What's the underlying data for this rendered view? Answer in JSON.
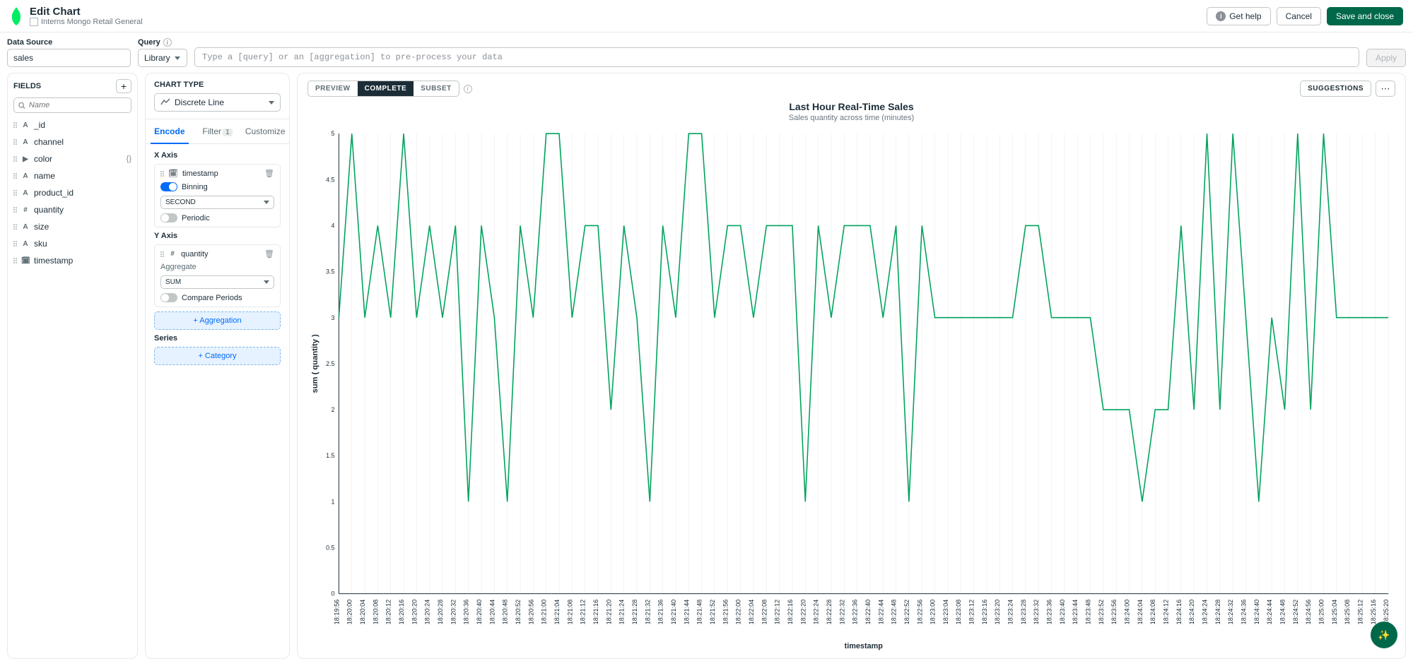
{
  "header": {
    "title": "Edit Chart",
    "breadcrumb": "Interns Mongo Retail General",
    "get_help": "Get help",
    "cancel": "Cancel",
    "save": "Save and close"
  },
  "query": {
    "data_source_label": "Data Source",
    "data_source_value": "sales",
    "query_label": "Query",
    "library_label": "Library",
    "query_placeholder": "Type a [query] or an [aggregation] to pre-process your data",
    "apply": "Apply"
  },
  "fields": {
    "header": "FIELDS",
    "search_placeholder": "Name",
    "items": [
      {
        "icon": "A",
        "name": "_id"
      },
      {
        "icon": "A",
        "name": "channel"
      },
      {
        "icon": "▶",
        "name": "color",
        "extra": "{}"
      },
      {
        "icon": "A",
        "name": "name"
      },
      {
        "icon": "A",
        "name": "product_id"
      },
      {
        "icon": "#",
        "name": "quantity"
      },
      {
        "icon": "A",
        "name": "size"
      },
      {
        "icon": "A",
        "name": "sku"
      },
      {
        "icon": "🗓",
        "name": "timestamp"
      }
    ]
  },
  "config": {
    "chart_type_label": "CHART TYPE",
    "chart_type_value": "Discrete Line",
    "tabs": {
      "encode": "Encode",
      "filter": "Filter",
      "filter_badge": "1",
      "customize": "Customize"
    },
    "x_axis_label": "X Axis",
    "x_field": "timestamp",
    "binning_label": "Binning",
    "binning_value": "SECOND",
    "periodic_label": "Periodic",
    "y_axis_label": "Y Axis",
    "y_field": "quantity",
    "aggregate_label": "Aggregate",
    "aggregate_value": "SUM",
    "compare_label": "Compare Periods",
    "add_agg": "+ Aggregation",
    "series_label": "Series",
    "add_cat": "+ Category"
  },
  "chart": {
    "tabs": {
      "preview": "PREVIEW",
      "complete": "COMPLETE",
      "subset": "SUBSET"
    },
    "suggestions": "SUGGESTIONS",
    "title": "Last Hour Real-Time Sales",
    "subtitle": "Sales quantity across time (minutes)",
    "ylabel": "sum ( quantity )",
    "xlabel": "timestamp",
    "yticks": [
      "0",
      "0.5",
      "1",
      "1.5",
      "2",
      "2.5",
      "3",
      "3.5",
      "4",
      "4.5",
      "5"
    ],
    "color": "#00a35c"
  },
  "chart_data": {
    "type": "line",
    "title": "Last Hour Real-Time Sales",
    "subtitle": "Sales quantity across time (minutes)",
    "xlabel": "timestamp",
    "ylabel": "sum ( quantity )",
    "ylim": [
      0,
      5
    ],
    "categories": [
      "18:19:56",
      "18:20:00",
      "18:20:04",
      "18:20:08",
      "18:20:12",
      "18:20:16",
      "18:20:20",
      "18:20:24",
      "18:20:28",
      "18:20:32",
      "18:20:36",
      "18:20:40",
      "18:20:44",
      "18:20:48",
      "18:20:52",
      "18:20:56",
      "18:21:00",
      "18:21:04",
      "18:21:08",
      "18:21:12",
      "18:21:16",
      "18:21:20",
      "18:21:24",
      "18:21:28",
      "18:21:32",
      "18:21:36",
      "18:21:40",
      "18:21:44",
      "18:21:48",
      "18:21:52",
      "18:21:56",
      "18:22:00",
      "18:22:04",
      "18:22:08",
      "18:22:12",
      "18:22:16",
      "18:22:20",
      "18:22:24",
      "18:22:28",
      "18:22:32",
      "18:22:36",
      "18:22:40",
      "18:22:44",
      "18:22:48",
      "18:22:52",
      "18:22:56",
      "18:23:00",
      "18:23:04",
      "18:23:08",
      "18:23:12",
      "18:23:16",
      "18:23:20",
      "18:23:24",
      "18:23:28",
      "18:23:32",
      "18:23:36",
      "18:23:40",
      "18:23:44",
      "18:23:48",
      "18:23:52",
      "18:23:56",
      "18:24:00",
      "18:24:04",
      "18:24:08",
      "18:24:12",
      "18:24:16",
      "18:24:20",
      "18:24:24",
      "18:24:28",
      "18:24:32",
      "18:24:36",
      "18:24:40",
      "18:24:44",
      "18:24:48",
      "18:24:52",
      "18:24:56",
      "18:25:00",
      "18:25:04",
      "18:25:08",
      "18:25:12",
      "18:25:16",
      "18:25:20"
    ],
    "values": [
      3,
      5,
      3,
      4,
      3,
      5,
      3,
      4,
      3,
      4,
      1,
      4,
      3,
      1,
      4,
      3,
      5,
      5,
      3,
      4,
      4,
      2,
      4,
      3,
      1,
      4,
      3,
      5,
      5,
      3,
      4,
      4,
      3,
      4,
      4,
      4,
      1,
      4,
      3,
      4,
      4,
      4,
      3,
      4,
      1,
      4,
      3,
      3,
      3,
      3,
      3,
      3,
      3,
      4,
      4,
      3,
      3,
      3,
      3,
      2,
      2,
      2,
      1,
      2,
      2,
      4,
      2,
      5,
      2,
      5,
      3,
      1,
      3,
      2,
      5,
      2,
      5,
      3,
      3,
      3,
      3,
      3
    ]
  }
}
